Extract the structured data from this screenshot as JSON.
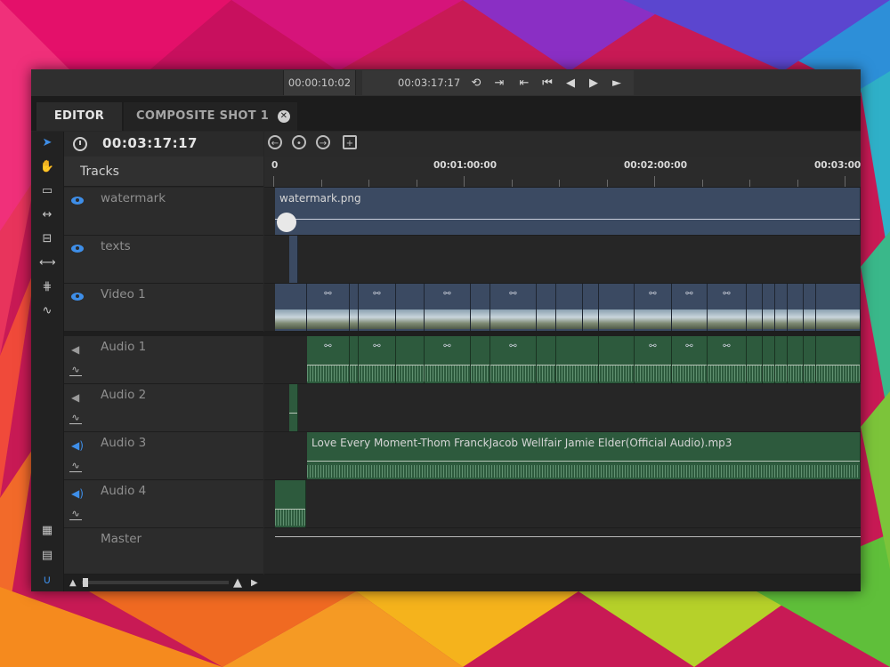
{
  "transport": {
    "timecode_in": "00:00:10:02",
    "timecode_current": "00:03:17:17",
    "buttons": [
      "loop-icon",
      "mark-out-icon",
      "mark-in-icon",
      "go-start-icon",
      "step-back-icon",
      "step-forward-icon",
      "play-icon"
    ]
  },
  "tabs": [
    {
      "label": "EDITOR",
      "active": true
    },
    {
      "label": "COMPOSITE SHOT 1",
      "active": false,
      "closable": true
    }
  ],
  "timeline": {
    "current_time": "00:03:17:17",
    "tracks_label": "Tracks",
    "ruler": [
      "0",
      "00:01:00:00",
      "00:02:00:00",
      "00:03:00"
    ]
  },
  "tracks": [
    {
      "name": "watermark",
      "kind": "video",
      "visible": true
    },
    {
      "name": "texts",
      "kind": "video",
      "visible": true
    },
    {
      "name": "Video 1",
      "kind": "video",
      "visible": true
    },
    {
      "name": "Audio 1",
      "kind": "audio",
      "enabled": false
    },
    {
      "name": "Audio 2",
      "kind": "audio",
      "enabled": false
    },
    {
      "name": "Audio 3",
      "kind": "audio",
      "enabled": true
    },
    {
      "name": "Audio 4",
      "kind": "audio",
      "enabled": true
    },
    {
      "name": "Master",
      "kind": "master"
    }
  ],
  "clips": {
    "watermark_clip": "watermark.png",
    "audio3_clip": "Love Every Moment-Thom FranckJacob Wellfair  Jamie Elder(Official Audio).mp3"
  },
  "colors": {
    "accent": "#3e8ee8",
    "video_clip": "#3b4a62",
    "audio_clip": "#2d5a3d"
  }
}
